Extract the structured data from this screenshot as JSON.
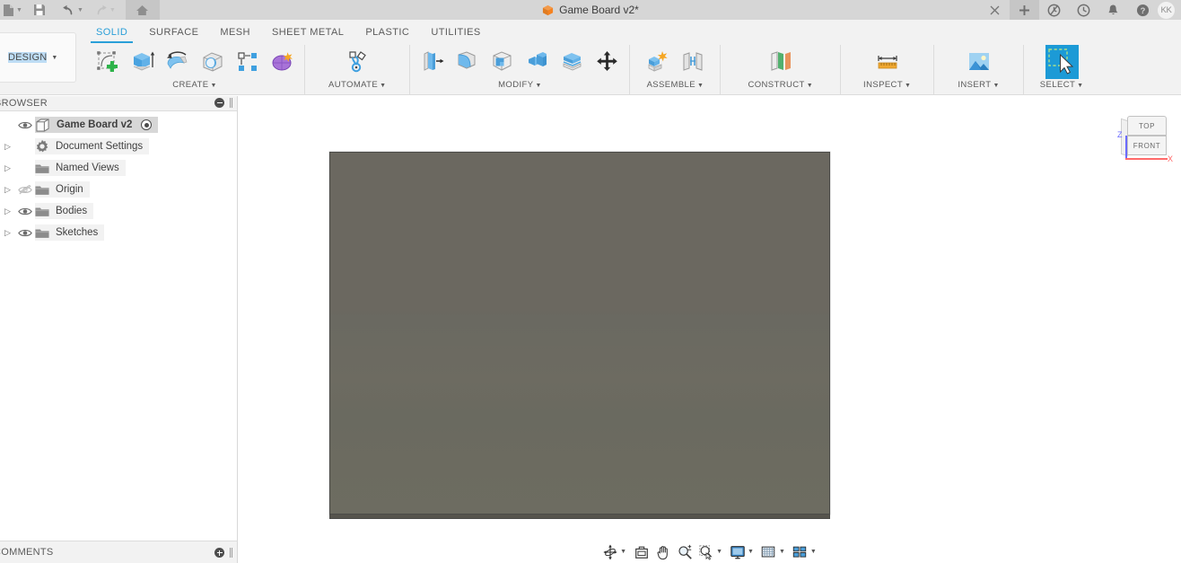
{
  "titlebar": {
    "file_icon": "file-icon",
    "save_icon": "save-icon",
    "undo_icon": "undo-icon",
    "redo_icon": "redo-icon",
    "home_icon": "home-icon",
    "document_title": "Game Board v2*",
    "doc_icon": "orange-cube-icon",
    "close_label": "×",
    "new_tab_label": "+",
    "icons": [
      "job-status-icon",
      "recent-icon",
      "notifications-icon",
      "help-icon"
    ],
    "avatar_initials": "KK"
  },
  "ribbon": {
    "design_label": "DESIGN",
    "design_label_highlight": "DESIGN",
    "tabs": [
      {
        "label": "SOLID",
        "active": true
      },
      {
        "label": "SURFACE",
        "active": false
      },
      {
        "label": "MESH",
        "active": false
      },
      {
        "label": "SHEET METAL",
        "active": false
      },
      {
        "label": "PLASTIC",
        "active": false
      },
      {
        "label": "UTILITIES",
        "active": false
      }
    ],
    "groups": [
      {
        "label": "CREATE",
        "has_caret": true,
        "buttons": [
          {
            "name": "create-sketch-button"
          },
          {
            "name": "extrude-button"
          },
          {
            "name": "revolve-button"
          },
          {
            "name": "sphere-button"
          },
          {
            "name": "pattern-button"
          },
          {
            "name": "form-button"
          }
        ]
      },
      {
        "label": "AUTOMATE",
        "has_caret": true,
        "buttons": [
          {
            "name": "automate-button"
          }
        ]
      },
      {
        "label": "MODIFY",
        "has_caret": true,
        "buttons": [
          {
            "name": "press-pull-button"
          },
          {
            "name": "fillet-button"
          },
          {
            "name": "shell-button"
          },
          {
            "name": "combine-button"
          },
          {
            "name": "offset-face-button"
          },
          {
            "name": "move-copy-button"
          }
        ]
      },
      {
        "label": "ASSEMBLE",
        "has_caret": true,
        "buttons": [
          {
            "name": "new-component-button"
          },
          {
            "name": "joint-button"
          }
        ]
      },
      {
        "label": "CONSTRUCT",
        "has_caret": true,
        "buttons": [
          {
            "name": "offset-plane-button"
          }
        ]
      },
      {
        "label": "INSPECT",
        "has_caret": true,
        "buttons": [
          {
            "name": "measure-button"
          }
        ]
      },
      {
        "label": "INSERT",
        "has_caret": true,
        "buttons": [
          {
            "name": "insert-image-button"
          }
        ]
      },
      {
        "label": "SELECT",
        "has_caret": true,
        "buttons": [
          {
            "name": "select-button",
            "selected": true
          }
        ]
      }
    ]
  },
  "browser": {
    "panel_title": "BROWSER",
    "collapse_icon": "collapse-minus-icon",
    "tree": [
      {
        "label": "Game Board v2",
        "type": "root",
        "eye": "visible",
        "has_arrow": false,
        "selected": true,
        "bold": true,
        "radio": true
      },
      {
        "label": "Document Settings",
        "type": "settings",
        "eye": "none",
        "has_arrow": true,
        "selected": false,
        "bold": false,
        "radio": false
      },
      {
        "label": "Named Views",
        "type": "folder",
        "eye": "none",
        "has_arrow": true,
        "selected": false,
        "bold": false,
        "radio": false
      },
      {
        "label": "Origin",
        "type": "folder",
        "eye": "hidden",
        "has_arrow": true,
        "selected": false,
        "bold": false,
        "radio": false
      },
      {
        "label": "Bodies",
        "type": "folder",
        "eye": "visible",
        "has_arrow": true,
        "selected": false,
        "bold": false,
        "radio": false
      },
      {
        "label": "Sketches",
        "type": "folder",
        "eye": "visible",
        "has_arrow": true,
        "selected": false,
        "bold": false,
        "radio": false
      }
    ]
  },
  "comments": {
    "panel_title": "COMMENTS",
    "add_icon": "add-comment-icon"
  },
  "canvas": {
    "model_name": "game-board-plate",
    "model_color": "#6b6860",
    "model_edge_color": "#56544d",
    "viewcube": {
      "top_face": "TOP",
      "front_face": "FRONT",
      "axis_z": "Z",
      "axis_x": "X",
      "axis_z_color": "#6a6aff",
      "axis_x_color": "#ff6a6a"
    }
  },
  "navbar": {
    "items": [
      {
        "name": "orbit-button",
        "icon": "orbit-icon",
        "caret": true
      },
      {
        "name": "look-at-button",
        "icon": "look-at-icon",
        "caret": false
      },
      {
        "name": "pan-button",
        "icon": "pan-hand-icon",
        "caret": false
      },
      {
        "name": "zoom-button",
        "icon": "zoom-icon",
        "caret": false
      },
      {
        "name": "zoom-window-button",
        "icon": "zoom-window-icon",
        "caret": true
      },
      {
        "name": "display-settings-button",
        "icon": "monitor-icon",
        "caret": true
      },
      {
        "name": "grid-snaps-button",
        "icon": "grid-icon",
        "caret": true
      },
      {
        "name": "viewports-button",
        "icon": "viewports-icon",
        "caret": true
      }
    ]
  }
}
